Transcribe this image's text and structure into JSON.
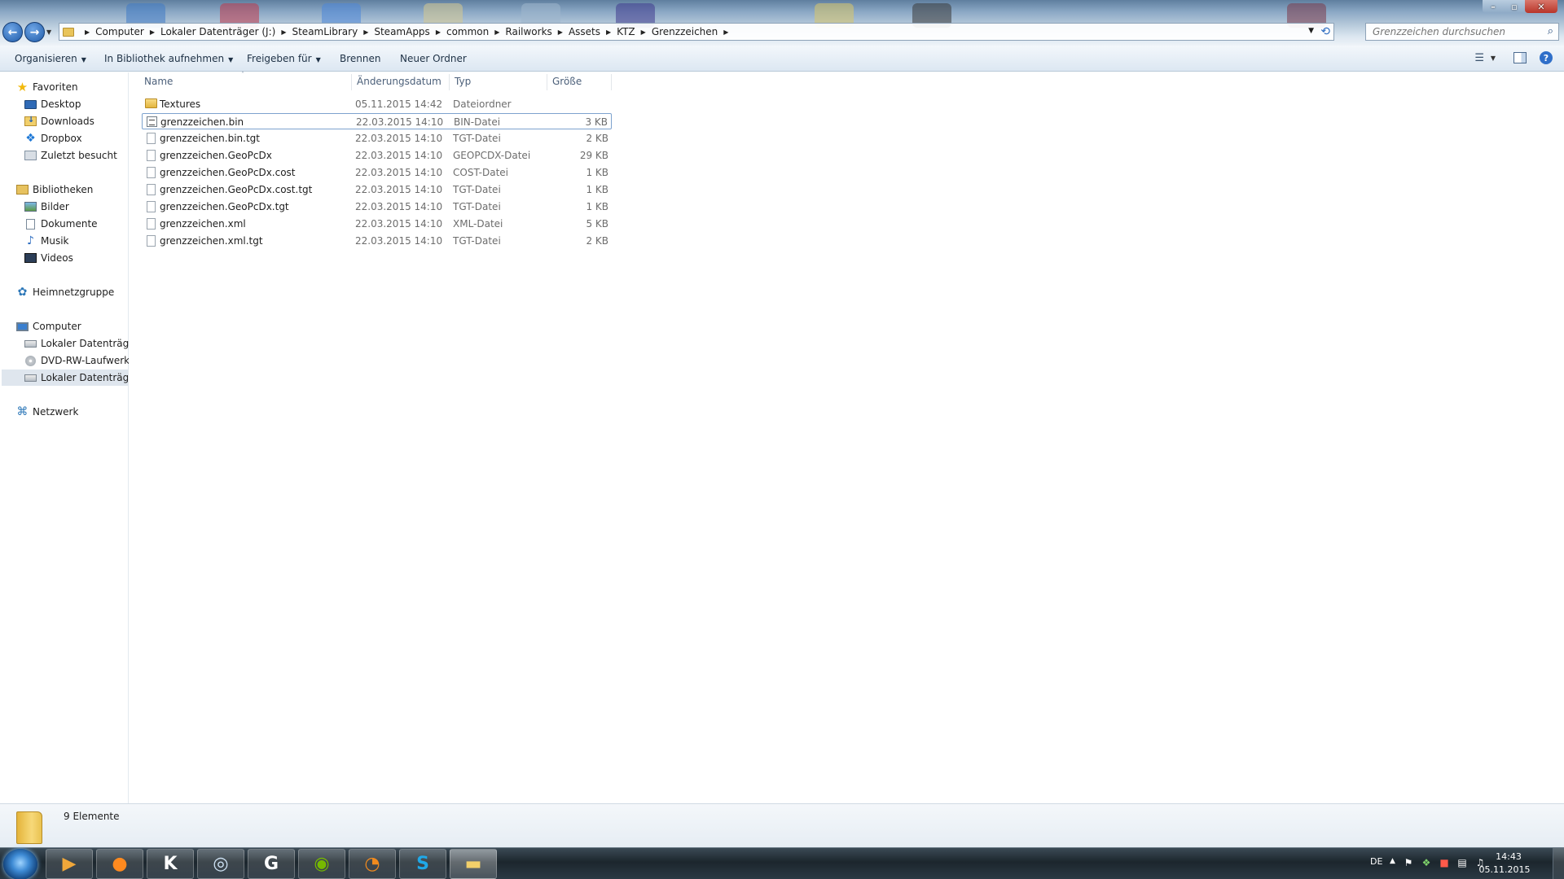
{
  "address": {
    "breadcrumbs": [
      "Computer",
      "Lokaler Datenträger (J:)",
      "SteamLibrary",
      "SteamApps",
      "common",
      "Railworks",
      "Assets",
      "KTZ",
      "Grenzzeichen"
    ]
  },
  "search": {
    "placeholder": "Grenzzeichen durchsuchen"
  },
  "commandbar": {
    "organize": "Organisieren",
    "include_library": "In Bibliothek aufnehmen",
    "share_with": "Freigeben für",
    "burn": "Brennen",
    "new_folder": "Neuer Ordner"
  },
  "nav": {
    "favorites": "Favoriten",
    "desktop": "Desktop",
    "downloads": "Downloads",
    "dropbox": "Dropbox",
    "recent": "Zuletzt besucht",
    "libraries": "Bibliotheken",
    "pictures": "Bilder",
    "documents": "Dokumente",
    "music": "Musik",
    "videos": "Videos",
    "homegroup": "Heimnetzgruppe",
    "computer": "Computer",
    "local_disk_c": "Lokaler Datenträger",
    "dvd_drive": "DVD-RW-Laufwerk (",
    "local_disk_j": "Lokaler Datenträger",
    "network": "Netzwerk"
  },
  "columns": {
    "name": "Name",
    "date": "Änderungsdatum",
    "type": "Typ",
    "size": "Größe"
  },
  "files": [
    {
      "name": "Textures",
      "date": "05.11.2015 14:42",
      "type": "Dateiordner",
      "size": "",
      "icon": "folder-icon"
    },
    {
      "name": "grenzzeichen.bin",
      "date": "22.03.2015 14:10",
      "type": "BIN-Datei",
      "size": "3 KB",
      "icon": "bin-file-icon"
    },
    {
      "name": "grenzzeichen.bin.tgt",
      "date": "22.03.2015 14:10",
      "type": "TGT-Datei",
      "size": "2 KB",
      "icon": "file-icon"
    },
    {
      "name": "grenzzeichen.GeoPcDx",
      "date": "22.03.2015 14:10",
      "type": "GEOPCDX-Datei",
      "size": "29 KB",
      "icon": "file-icon"
    },
    {
      "name": "grenzzeichen.GeoPcDx.cost",
      "date": "22.03.2015 14:10",
      "type": "COST-Datei",
      "size": "1 KB",
      "icon": "file-icon"
    },
    {
      "name": "grenzzeichen.GeoPcDx.cost.tgt",
      "date": "22.03.2015 14:10",
      "type": "TGT-Datei",
      "size": "1 KB",
      "icon": "file-icon"
    },
    {
      "name": "grenzzeichen.GeoPcDx.tgt",
      "date": "22.03.2015 14:10",
      "type": "TGT-Datei",
      "size": "1 KB",
      "icon": "file-icon"
    },
    {
      "name": "grenzzeichen.xml",
      "date": "22.03.2015 14:10",
      "type": "XML-Datei",
      "size": "5 KB",
      "icon": "file-icon"
    },
    {
      "name": "grenzzeichen.xml.tgt",
      "date": "22.03.2015 14:10",
      "type": "TGT-Datei",
      "size": "2 KB",
      "icon": "file-icon"
    }
  ],
  "details": {
    "count": "9 Elemente"
  },
  "taskbar": {
    "apps": [
      "media-player-icon",
      "firefox-icon",
      "k-app-icon",
      "steam-icon",
      "g-app-icon",
      "nvidia-icon",
      "blender-icon",
      "skype-icon",
      "explorer-icon"
    ],
    "language": "DE",
    "time": "14:43",
    "date": "05.11.2015"
  }
}
